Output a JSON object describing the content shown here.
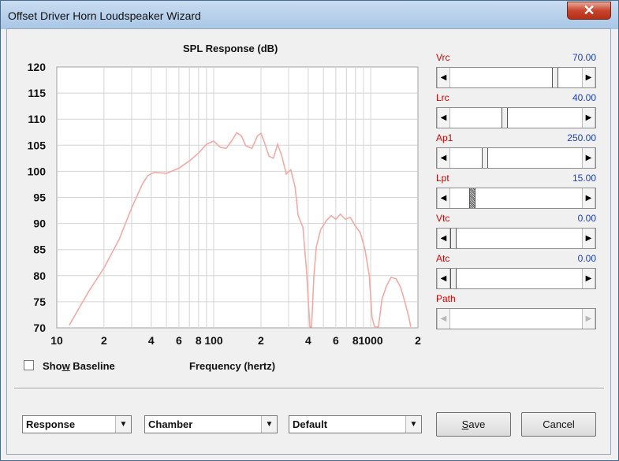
{
  "window": {
    "title": "Offset Driver Horn Loudspeaker Wizard",
    "close_glyph": "✕"
  },
  "chart_data": {
    "type": "line",
    "title": "SPL Response (dB)",
    "xlabel": "Frequency (hertz)",
    "ylabel": "",
    "x_scale": "log",
    "xlim": [
      10,
      2000
    ],
    "ylim": [
      70,
      120
    ],
    "y_ticks": [
      120,
      115,
      110,
      105,
      100,
      95,
      90,
      85,
      80,
      75,
      70
    ],
    "x_tick_labels": [
      "10",
      "2",
      "4",
      "6",
      "8",
      "100",
      "2",
      "4",
      "6",
      "8",
      "1000",
      "2"
    ],
    "grid": true,
    "series": [
      {
        "color": "#f4a9a4",
        "points": [
          [
            12,
            70.5
          ],
          [
            16,
            77
          ],
          [
            20,
            81.5
          ],
          [
            25,
            87
          ],
          [
            30,
            93
          ],
          [
            35,
            97.5
          ],
          [
            38,
            99.2
          ],
          [
            42,
            99.8
          ],
          [
            50,
            99.6
          ],
          [
            60,
            100.6
          ],
          [
            70,
            102
          ],
          [
            80,
            103.5
          ],
          [
            90,
            105.2
          ],
          [
            100,
            105.8
          ],
          [
            110,
            104.6
          ],
          [
            120,
            104.4
          ],
          [
            130,
            105.8
          ],
          [
            140,
            107.4
          ],
          [
            150,
            106.8
          ],
          [
            160,
            104.9
          ],
          [
            175,
            104.4
          ],
          [
            190,
            106.8
          ],
          [
            200,
            107.3
          ],
          [
            210,
            105.6
          ],
          [
            225,
            102.9
          ],
          [
            240,
            102.5
          ],
          [
            255,
            105.2
          ],
          [
            270,
            103.2
          ],
          [
            290,
            99.5
          ],
          [
            310,
            100.3
          ],
          [
            330,
            97
          ],
          [
            345,
            91.5
          ],
          [
            370,
            89.3
          ],
          [
            390,
            81
          ],
          [
            410,
            70.2
          ],
          [
            420,
            70.2
          ],
          [
            435,
            80
          ],
          [
            450,
            85.5
          ],
          [
            480,
            88.8
          ],
          [
            520,
            90.5
          ],
          [
            560,
            91.5
          ],
          [
            600,
            90.8
          ],
          [
            640,
            91.8
          ],
          [
            690,
            90.8
          ],
          [
            740,
            91.2
          ],
          [
            800,
            89.5
          ],
          [
            860,
            88.2
          ],
          [
            920,
            85
          ],
          [
            980,
            80
          ],
          [
            1020,
            72
          ],
          [
            1060,
            70.1
          ],
          [
            1120,
            70.2
          ],
          [
            1180,
            75.5
          ],
          [
            1260,
            78
          ],
          [
            1350,
            79.7
          ],
          [
            1450,
            79.4
          ],
          [
            1550,
            77.8
          ],
          [
            1650,
            75
          ],
          [
            1750,
            72
          ],
          [
            1800,
            70.2
          ]
        ]
      }
    ]
  },
  "controls": [
    {
      "name": "Vrc",
      "value": "70.00",
      "fraction": 0.81,
      "disabled": false
    },
    {
      "name": "Lrc",
      "value": "40.00",
      "fraction": 0.41,
      "disabled": false
    },
    {
      "name": "Ap1",
      "value": "250.00",
      "fraction": 0.25,
      "disabled": false
    },
    {
      "name": "Lpt",
      "value": "15.00",
      "fraction": 0.15,
      "disabled": false
    },
    {
      "name": "Vtc",
      "value": "0.00",
      "fraction": 0.0,
      "disabled": false
    },
    {
      "name": "Atc",
      "value": "0.00",
      "fraction": 0.0,
      "disabled": false
    },
    {
      "name": "Path",
      "value": "",
      "fraction": 0.0,
      "disabled": true
    }
  ],
  "show_baseline": {
    "prefix": "Sho",
    "accel": "w",
    "suffix": " Baseline",
    "checked": false
  },
  "combos": [
    {
      "value": "Response"
    },
    {
      "value": "Chamber"
    },
    {
      "value": "Default"
    }
  ],
  "buttons": {
    "save_accel": "S",
    "save_rest": "ave",
    "cancel": "Cancel"
  },
  "glyphs": {
    "left": "◀",
    "right": "▶",
    "down": "▼"
  },
  "colors": {
    "curve": "#f4a9a4",
    "grid": "#d4d4d4",
    "control_name": "#d40000",
    "control_value": "#1a3fc0"
  }
}
